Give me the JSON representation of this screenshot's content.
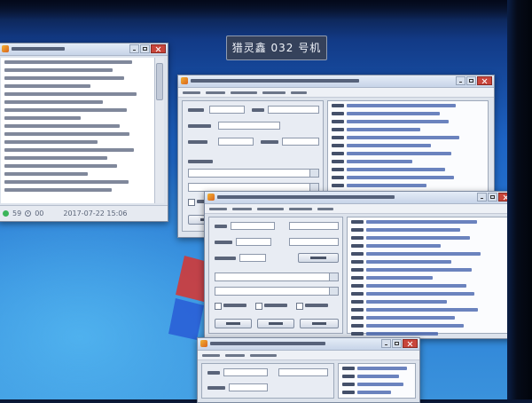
{
  "desktop": {
    "machine_label": "猎灵鑫 032 号机",
    "colors": {
      "desktop_blue": "#1d63c4",
      "window_frame": "#dde3ec",
      "title_bar": "#c7d4e8",
      "list_text": "#3b5ba8",
      "alert_red": "#d8282e"
    }
  },
  "left_window": {
    "status_bar": {
      "count_a": "59",
      "count_b": "00",
      "timestamp": "2017-07-22 15:06"
    }
  }
}
